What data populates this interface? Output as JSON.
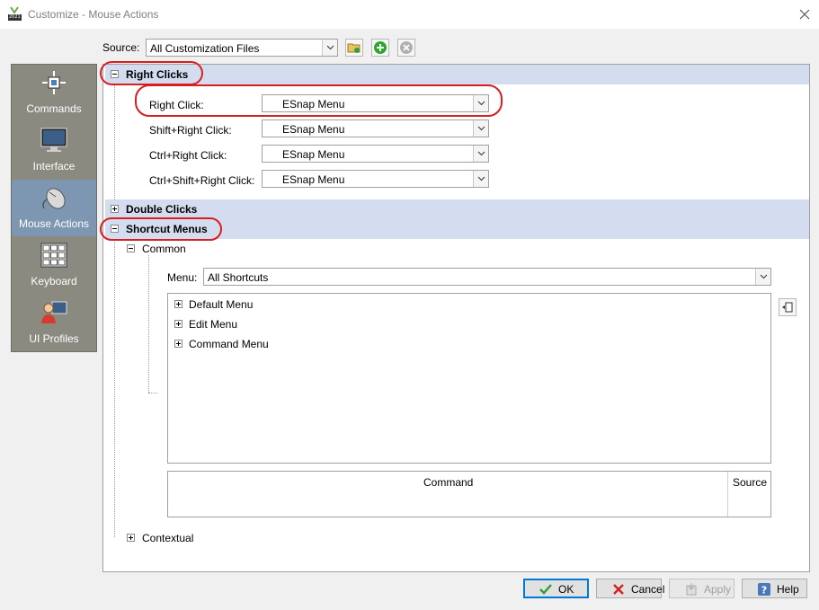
{
  "window": {
    "title": "Customize - Mouse Actions",
    "app_icon_badge": "2021"
  },
  "source": {
    "label": "Source:",
    "value": "All Customization Files"
  },
  "nav": {
    "items": [
      {
        "label": "Commands",
        "icon": "commands-icon"
      },
      {
        "label": "Interface",
        "icon": "monitor-icon"
      },
      {
        "label": "Mouse Actions",
        "icon": "mouse-icon",
        "selected": true
      },
      {
        "label": "Keyboard",
        "icon": "keyboard-icon"
      },
      {
        "label": "UI Profiles",
        "icon": "user-profile-icon"
      }
    ]
  },
  "right_clicks": {
    "header": "Right Clicks",
    "rows": [
      {
        "label": "Right Click:",
        "value": "ESnap Menu"
      },
      {
        "label": "Shift+Right Click:",
        "value": "ESnap Menu"
      },
      {
        "label": "Ctrl+Right Click:",
        "value": "ESnap Menu"
      },
      {
        "label": "Ctrl+Shift+Right Click:",
        "value": "ESnap Menu"
      }
    ]
  },
  "double_clicks": {
    "header": "Double Clicks"
  },
  "shortcut_menus": {
    "header": "Shortcut Menus",
    "common_label": "Common",
    "menu_label": "Menu:",
    "menu_value": "All Shortcuts",
    "tree_items": [
      "Default Menu",
      "Edit Menu",
      "Command Menu"
    ],
    "grid_columns": [
      "Command",
      "Source"
    ],
    "contextual_label": "Contextual"
  },
  "buttons": {
    "ok": "OK",
    "cancel": "Cancel",
    "apply": "Apply",
    "help": "Help"
  },
  "colors": {
    "annotation": "#d81e1e",
    "header_band": "#d4ddf0",
    "nav_bg": "#8a8a80",
    "nav_selected": "#7d97b2"
  }
}
